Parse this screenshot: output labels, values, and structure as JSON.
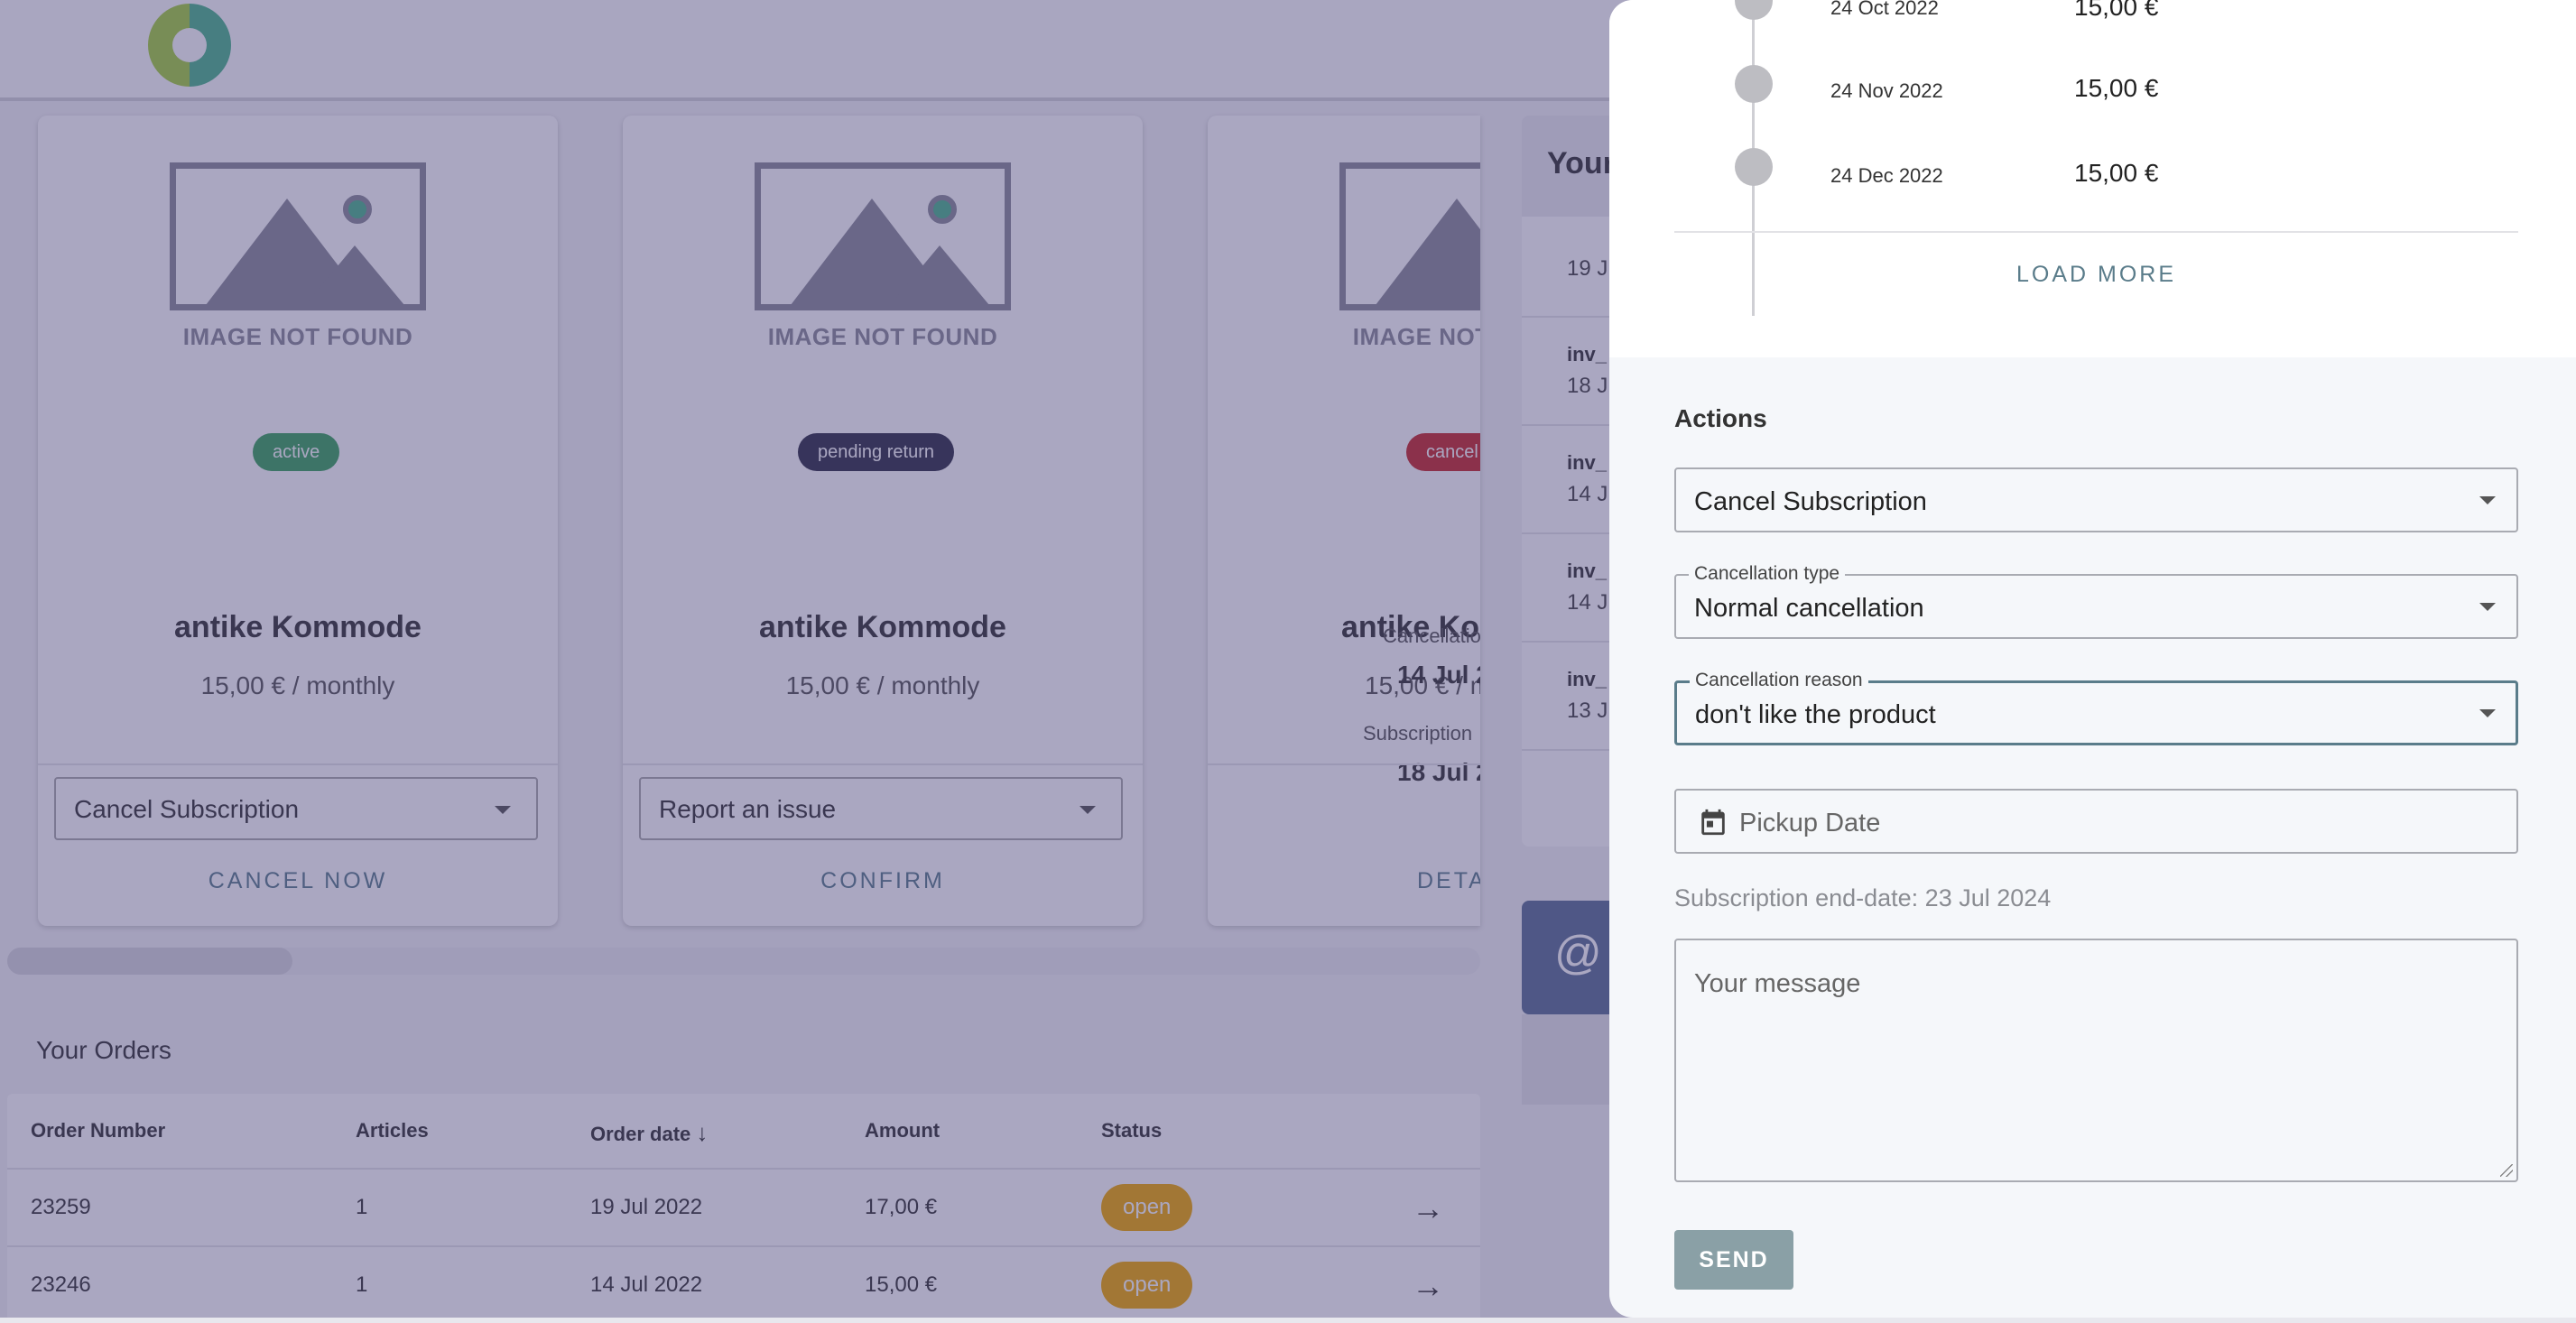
{
  "header": {
    "logo": "brand-logo"
  },
  "cards": [
    {
      "image_text": "IMAGE NOT FOUND",
      "status": "active",
      "status_color": "#3aa35b",
      "title": "antike Kommode",
      "price": "15,00 € / monthly",
      "select_value": "Cancel Subscription",
      "action": "CANCEL NOW"
    },
    {
      "image_text": "IMAGE NOT FOUND",
      "status": "pending return",
      "status_color": "#2f2f45",
      "title": "antike Kommode",
      "price": "15,00 € / monthly",
      "select_value": "Report an issue",
      "action": "CONFIRM"
    },
    {
      "image_text": "IMAGE NOT FOUND",
      "status": "cancel",
      "status_color": "#c62828",
      "title": "antike Ko",
      "price": "15,00 € / m",
      "cancellation_label": "Cancellatio",
      "cancellation_date": "14 Jul 2",
      "subscription_label": "Subscription",
      "subscription_date": "18 Jul 2",
      "action": "DETA"
    }
  ],
  "invoices": {
    "title": "Your",
    "rows": [
      {
        "date": "19 J"
      },
      {
        "id": "inv_",
        "date": "18 J"
      },
      {
        "id": "inv_",
        "date": "14 J"
      },
      {
        "id": "inv_",
        "date": "14 J"
      },
      {
        "id": "inv_",
        "date": "13 J"
      }
    ]
  },
  "contact": {
    "icon": "at-icon",
    "glyph": "@"
  },
  "orders": {
    "title": "Your Orders",
    "columns": [
      "Order Number",
      "Articles",
      "Order date",
      "Amount",
      "Status"
    ],
    "sort_indicator": "↓",
    "rows": [
      {
        "number": "23259",
        "articles": "1",
        "date": "19 Jul 2022",
        "amount": "17,00 €",
        "status": "open"
      },
      {
        "number": "23246",
        "articles": "1",
        "date": "14 Jul 2022",
        "amount": "15,00 €",
        "status": "open"
      }
    ]
  },
  "drawer": {
    "timeline": [
      {
        "date": "24 Oct 2022",
        "amount": "15,00 €"
      },
      {
        "date": "24 Nov 2022",
        "amount": "15,00 €"
      },
      {
        "date": "24 Dec 2022",
        "amount": "15,00 €"
      }
    ],
    "load_more": "LOAD MORE",
    "actions_title": "Actions",
    "action_select": "Cancel Subscription",
    "cancellation_type": {
      "label": "Cancellation type",
      "value": "Normal cancellation"
    },
    "cancellation_reason": {
      "label": "Cancellation reason",
      "value": "don't like the product"
    },
    "pickup_date_placeholder": "Pickup Date",
    "end_date_text": "Subscription end-date: 23 Jul 2024",
    "message_placeholder": "Your message",
    "send_label": "SEND"
  },
  "colors": {
    "accent": "#5a7c8a",
    "overlay": "#423c76",
    "status_open": "#f0a800"
  }
}
